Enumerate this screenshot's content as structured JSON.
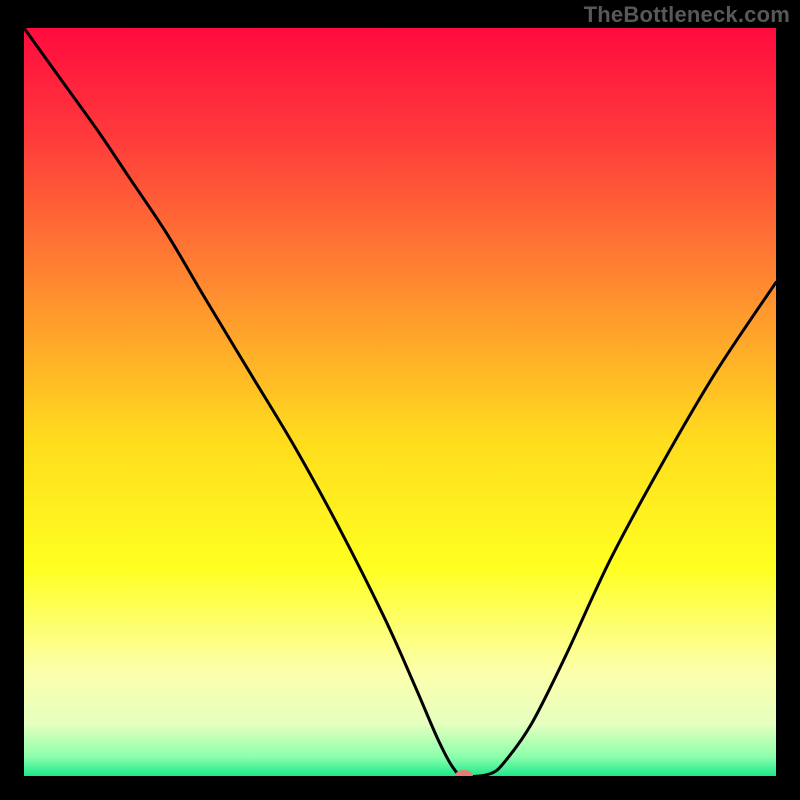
{
  "watermark": "TheBottleneck.com",
  "chart_data": {
    "type": "line",
    "title": "",
    "xlabel": "",
    "ylabel": "",
    "xlim": [
      0,
      100
    ],
    "ylim": [
      0,
      100
    ],
    "grid": false,
    "legend": false,
    "annotations": [],
    "background_gradient": {
      "stops": [
        {
          "pos": 0.0,
          "color": "#ff0b3f"
        },
        {
          "pos": 0.15,
          "color": "#ff3c3b"
        },
        {
          "pos": 0.35,
          "color": "#ff8c30"
        },
        {
          "pos": 0.55,
          "color": "#ffdc1e"
        },
        {
          "pos": 0.72,
          "color": "#ffff20"
        },
        {
          "pos": 0.86,
          "color": "#fcffab"
        },
        {
          "pos": 0.93,
          "color": "#e6ffbf"
        },
        {
          "pos": 0.975,
          "color": "#8affac"
        },
        {
          "pos": 1.0,
          "color": "#1de88a"
        }
      ]
    },
    "series": [
      {
        "name": "bottleneck-curve",
        "color": "#000000",
        "x": [
          0,
          5,
          10,
          14,
          19,
          24,
          30,
          36,
          42,
          48,
          52,
          55,
          57,
          58.5,
          62,
          64,
          67.5,
          72,
          78,
          85,
          92,
          100
        ],
        "values": [
          100,
          93,
          86,
          80,
          72.5,
          64,
          54,
          44,
          33,
          21,
          12,
          5,
          1.2,
          0,
          0.3,
          2,
          7,
          16,
          29,
          42,
          54,
          66
        ]
      }
    ],
    "marker": {
      "x": 58.5,
      "y": 0,
      "color": "#e77c6f",
      "rx": 9,
      "ry": 6
    }
  }
}
